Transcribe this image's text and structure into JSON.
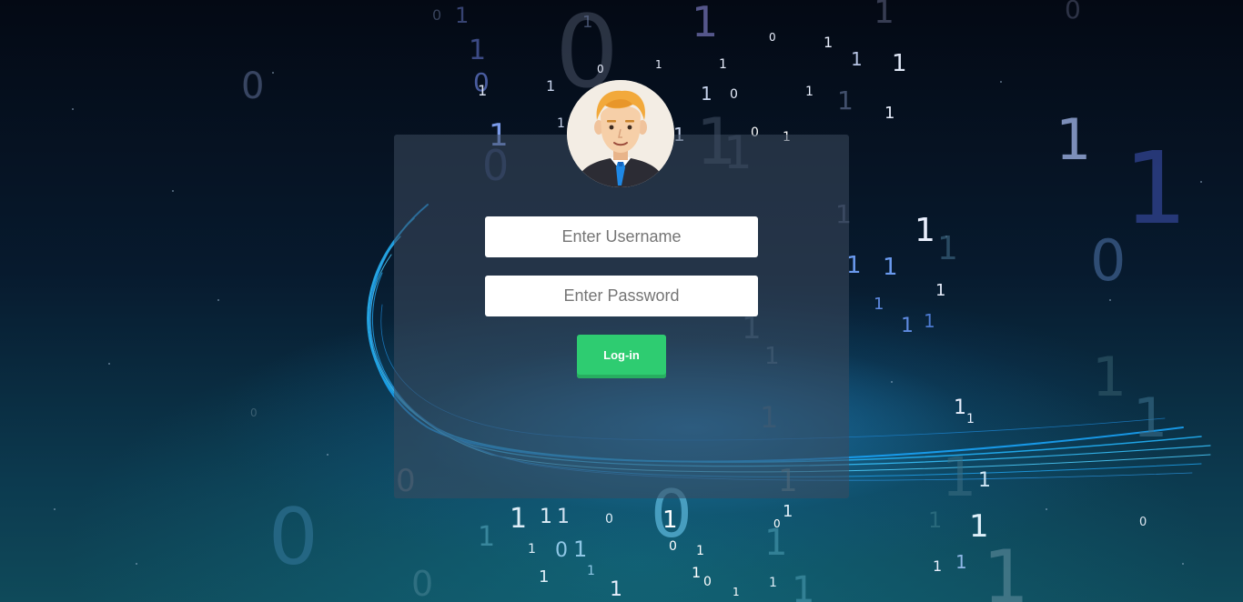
{
  "login": {
    "username_placeholder": "Enter Username",
    "password_placeholder": "Enter Password",
    "button_label": "Log-in"
  },
  "colors": {
    "button": "#2ecc71",
    "card": "#3c4b5f",
    "background": "#071a2e"
  },
  "icons": {
    "avatar": "businessman-avatar-icon"
  }
}
